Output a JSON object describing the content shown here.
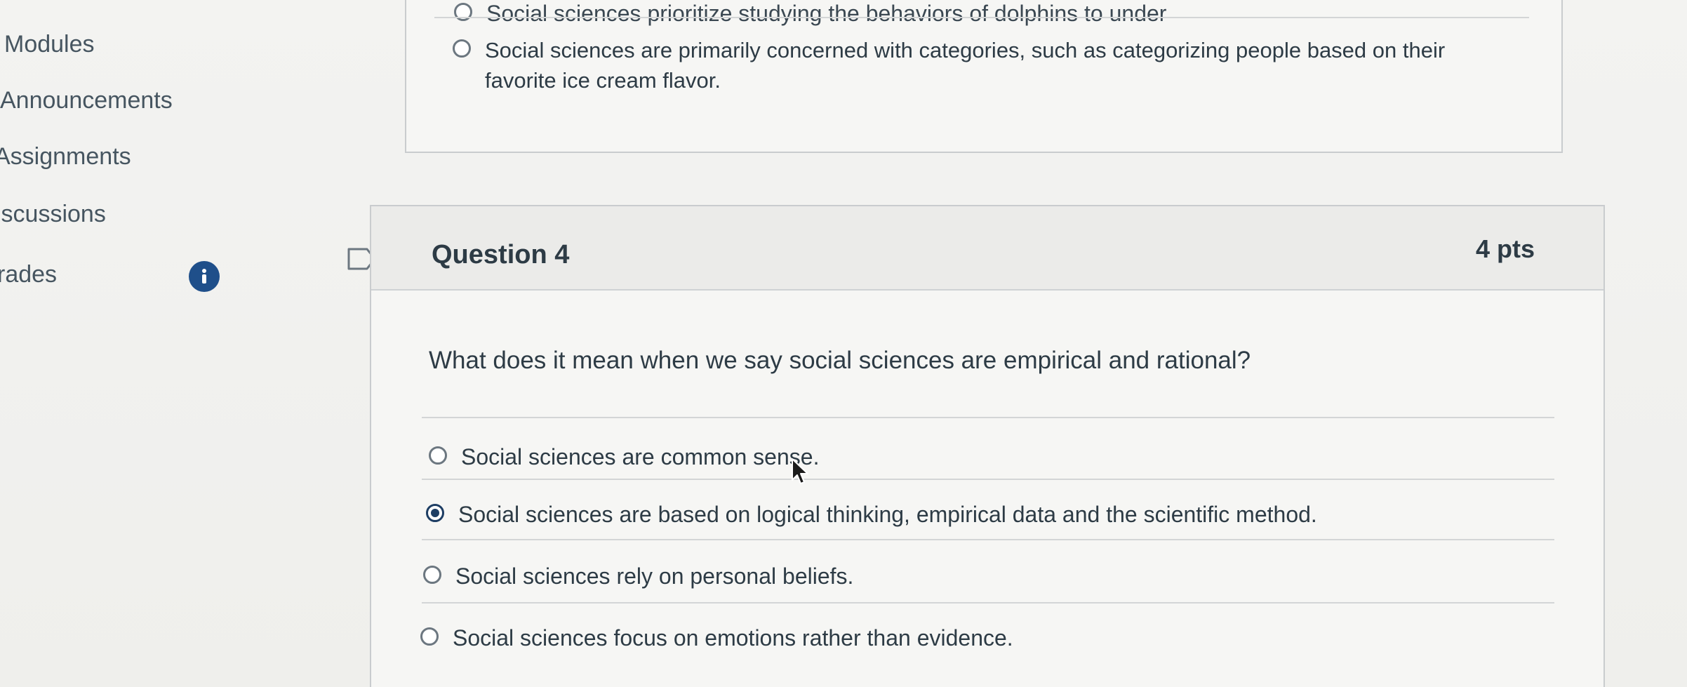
{
  "course_nav": {
    "items": [
      {
        "label": "Modules"
      },
      {
        "label": "Announcements"
      },
      {
        "label": "Assignments"
      },
      {
        "label": "iscussions"
      },
      {
        "label": "rades"
      }
    ],
    "grades_badge_icon": "info-icon"
  },
  "previous_question": {
    "answers": [
      {
        "label": "Social sciences prioritize studying the behaviors of dolphins to under",
        "selected": false
      },
      {
        "label": "Social sciences are primarily concerned with categories, such as categorizing people based on their favorite ice cream flavor.",
        "selected": false
      }
    ]
  },
  "question": {
    "title": "Question 4",
    "points": "4 pts",
    "text": "What does it mean when we say social sciences are empirical and rational?",
    "flag_icon": "flag-icon",
    "answers": [
      {
        "label": "Social sciences are common sense.",
        "selected": false
      },
      {
        "label": "Social sciences are based on logical thinking, empirical data and the scientific method.",
        "selected": true
      },
      {
        "label": "Social sciences rely on personal beliefs.",
        "selected": false
      },
      {
        "label": "Social sciences focus on emotions rather than evidence.",
        "selected": false
      }
    ]
  },
  "colors": {
    "text": "#2d3b45",
    "selected_radio": "#1d3d63",
    "badge": "#1f4f8a"
  }
}
